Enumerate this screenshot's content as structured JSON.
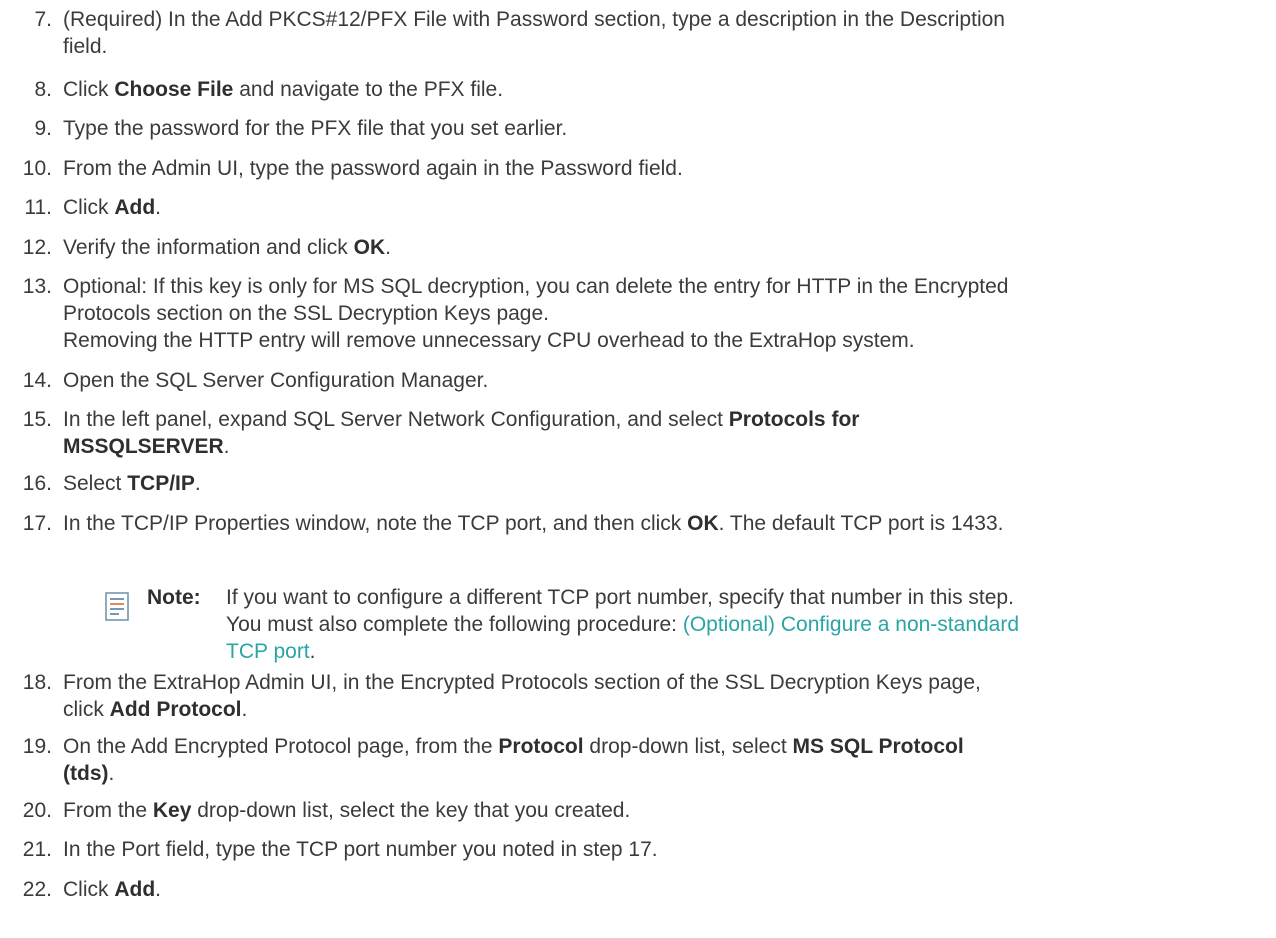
{
  "steps": [
    {
      "num": "7.",
      "a": "(Required) In the Add PKCS#12/PFX File with Password section, type a description in the Description",
      "b": "field."
    },
    {
      "num": "8.",
      "pre": "Click ",
      "bold": "Choose File",
      "post": " and navigate to the PFX file."
    },
    {
      "num": "9.",
      "text": "Type the password for the PFX file that you set earlier."
    },
    {
      "num": "10.",
      "text": "From the Admin UI, type the password again in the Password field."
    },
    {
      "num": "11.",
      "pre": "Click ",
      "bold": "Add",
      "post": "."
    },
    {
      "num": "12.",
      "pre": "Verify the information and click ",
      "bold": "OK",
      "post": "."
    },
    {
      "num": "13.",
      "a": "Optional: If this key is only for MS SQL decryption, you can delete the entry for HTTP in the Encrypted",
      "b": "Protocols section on the SSL Decryption Keys page.",
      "c": "Removing the HTTP entry will remove unnecessary CPU overhead to the ExtraHop system."
    },
    {
      "num": "14.",
      "text": "Open the SQL Server Configuration Manager."
    },
    {
      "num": "15.",
      "pre": "In the left panel, expand SQL Server Network Configuration, and select ",
      "bold1": "Protocols for",
      "bold2": "MSSQLSERVER",
      "post": "."
    },
    {
      "num": "16.",
      "pre": "Select ",
      "bold": "TCP/IP",
      "post": "."
    },
    {
      "num": "17.",
      "pre": "In the TCP/IP Properties window, note the TCP port, and then click ",
      "bold": "OK",
      "post": ". The default TCP port is 1433."
    },
    {
      "num": "18.",
      "a": "From the ExtraHop Admin UI, in the Encrypted Protocols section of the SSL Decryption Keys page,",
      "pre": "click ",
      "bold": "Add Protocol",
      "post": "."
    },
    {
      "num": "19.",
      "pre": "On the Add Encrypted Protocol page, from the ",
      "bold1": "Protocol",
      "mid": " drop-down list, select ",
      "bold2": "MS SQL Protocol",
      "bold3": "(tds)",
      "post": "."
    },
    {
      "num": "20.",
      "pre": "From the ",
      "bold": "Key",
      "post": " drop-down list, select the key that you created."
    },
    {
      "num": "21.",
      "text": "In the Port field, type the TCP port number you noted in step 17."
    },
    {
      "num": "22.",
      "pre": "Click ",
      "bold": "Add",
      "post": "."
    }
  ],
  "note": {
    "icon": "note-icon",
    "label": "Note:",
    "line1": "If you want to configure a different TCP port number, specify that number in this step.",
    "line2": "You must also complete the following procedure: ",
    "link1": "(Optional) Configure a non-standard",
    "link2": "TCP port",
    "end": ".",
    "link_color": "#2aa5a5"
  }
}
